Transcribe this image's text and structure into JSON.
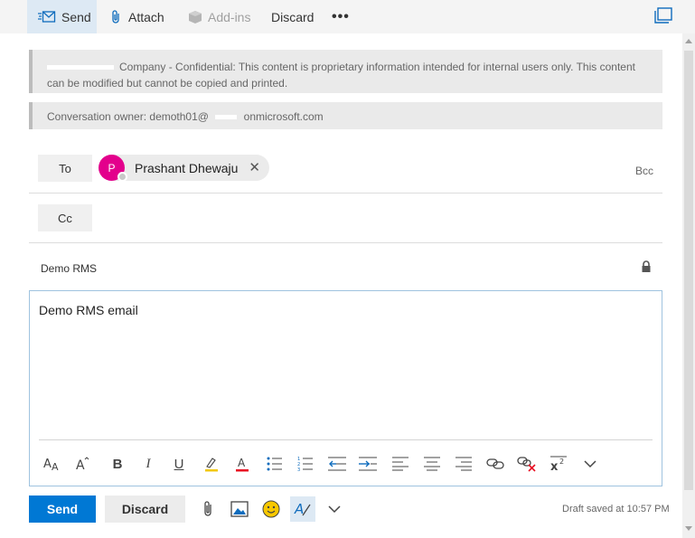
{
  "toolbar": {
    "send_label": "Send",
    "attach_label": "Attach",
    "addins_label": "Add-ins",
    "discard_label": "Discard",
    "more_label": "•••",
    "icons": [
      "send-icon",
      "paperclip-icon",
      "addins-icon",
      "popout-icon"
    ]
  },
  "banners": {
    "classification_text": "Company - Confidential: This content is proprietary information intended for internal users only. This content can be modified but cannot be copied and printed.",
    "owner_prefix": "Conversation owner: demoth01@",
    "owner_suffix": "onmicrosoft.com"
  },
  "recipients": {
    "to_label": "To",
    "cc_label": "Cc",
    "bcc_label": "Bcc",
    "to_chips": [
      {
        "initial": "P",
        "name": "Prashant Dhewaju",
        "avatar_color": "#e3008c"
      }
    ]
  },
  "subject": {
    "value": "Demo RMS",
    "icon": "lock-icon"
  },
  "body": {
    "text": "Demo RMS email"
  },
  "format_toolbar": [
    "font-size-icon",
    "grow-font-icon",
    "bold-icon",
    "italic-icon",
    "underline-icon",
    "highlight-icon",
    "font-color-icon",
    "bullets-icon",
    "numbering-icon",
    "decrease-indent-icon",
    "increase-indent-icon",
    "align-left-icon",
    "align-center-icon",
    "align-right-icon",
    "insert-link-icon",
    "remove-link-icon",
    "superscript-icon",
    "more-formatting-chevron-icon"
  ],
  "footer": {
    "send_label": "Send",
    "discard_label": "Discard",
    "draft_status": "Draft saved at 10:57 PM"
  },
  "colors": {
    "accent": "#0078d4",
    "selected_bg": "#dde9f4",
    "avatar": "#e3008c",
    "highlight_yellow": "#f2c811",
    "font_red": "#e81123"
  }
}
